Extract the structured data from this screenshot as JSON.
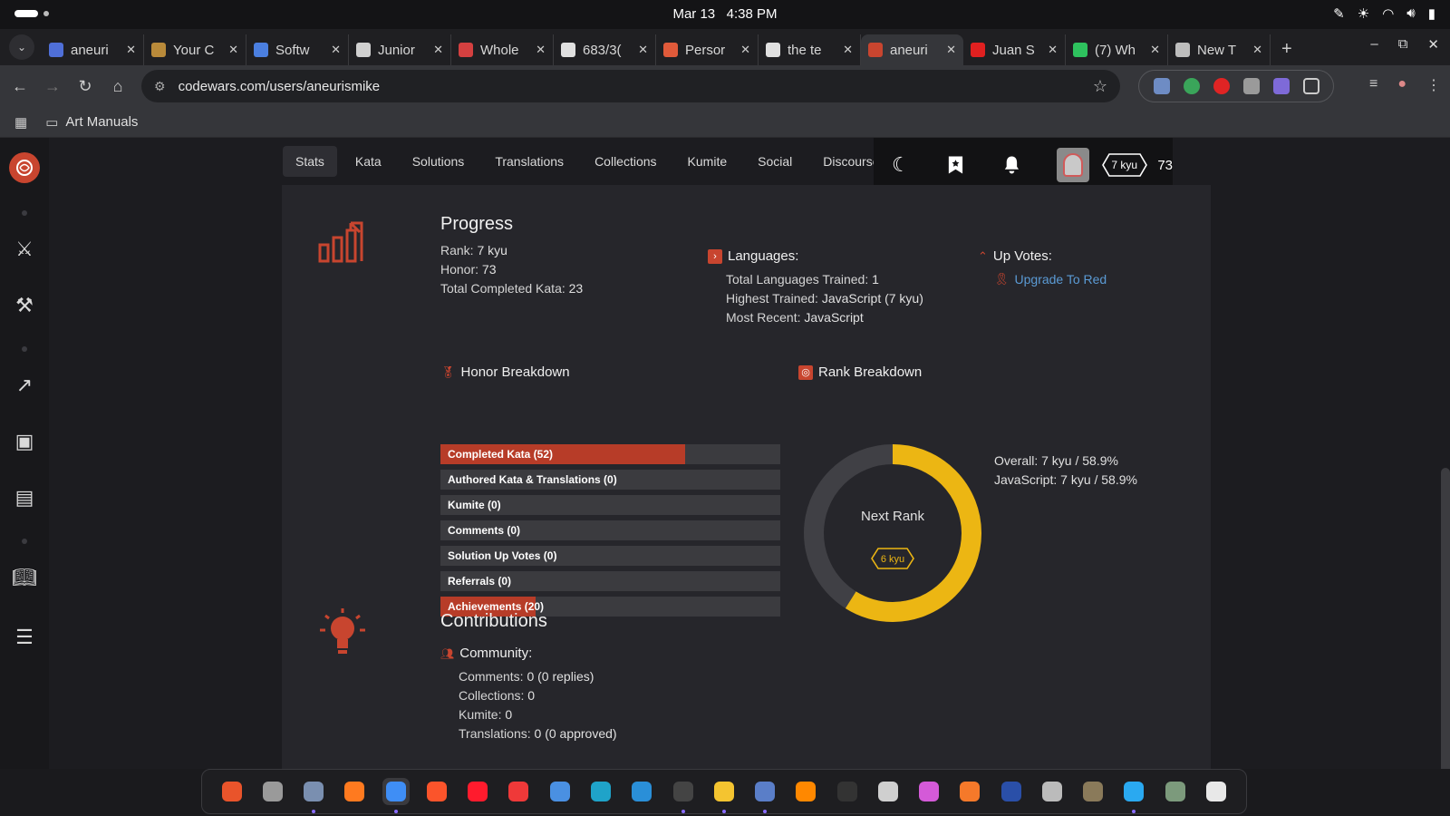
{
  "os": {
    "date": "Mar 13",
    "time": "4:38 PM"
  },
  "browser": {
    "tabs": [
      {
        "title": "aneuri",
        "color": "#4f6fd8"
      },
      {
        "title": "Your C",
        "color": "#b98a3a"
      },
      {
        "title": "Softw",
        "color": "#4b7fe0"
      },
      {
        "title": "Junior",
        "color": "#d0d0d0"
      },
      {
        "title": "Whole",
        "color": "#d44040"
      },
      {
        "title": "683/3(",
        "color": "#e0e0e0"
      },
      {
        "title": "Persor",
        "color": "#e05a3a"
      },
      {
        "title": "the te",
        "color": "#e0e0e0"
      },
      {
        "title": "aneuri",
        "color": "#c8452f",
        "active": true
      },
      {
        "title": "Juan S",
        "color": "#e02020"
      },
      {
        "title": "(7) Wh",
        "color": "#2ec25e"
      },
      {
        "title": "New T",
        "color": "#bdbdbd"
      }
    ],
    "url": "codewars.com/users/aneurismike",
    "bookmark_folder": "Art Manuals"
  },
  "profile_nav": [
    "Stats",
    "Kata",
    "Solutions",
    "Translations",
    "Collections",
    "Kumite",
    "Social",
    "Discourse"
  ],
  "user_badge": {
    "rank": "7 kyu",
    "honor": "73"
  },
  "progress": {
    "title": "Progress",
    "rank_label": "Rank:",
    "rank": "7 kyu",
    "honor_label": "Honor:",
    "honor": "73",
    "completed_label": "Total Completed Kata:",
    "completed": "23"
  },
  "languages": {
    "title": "Languages:",
    "trained_label": "Total Languages Trained:",
    "trained": "1",
    "highest_label": "Highest Trained:",
    "highest": "JavaScript (7 kyu)",
    "recent_label": "Most Recent:",
    "recent": "JavaScript"
  },
  "upvotes": {
    "title": "Up Votes:",
    "link": "Upgrade To Red"
  },
  "honor_breakdown": {
    "title": "Honor Breakdown",
    "bars": [
      {
        "label": "Completed Kata (52)",
        "fill_fraction": 0.72
      },
      {
        "label": "Authored Kata & Translations (0)",
        "fill_fraction": 0
      },
      {
        "label": "Kumite (0)",
        "fill_fraction": 0
      },
      {
        "label": "Comments (0)",
        "fill_fraction": 0
      },
      {
        "label": "Solution Up Votes (0)",
        "fill_fraction": 0
      },
      {
        "label": "Referrals (0)",
        "fill_fraction": 0
      },
      {
        "label": "Achievements (20)",
        "fill_fraction": 0.28
      }
    ]
  },
  "rank_breakdown": {
    "title": "Rank Breakdown",
    "next_rank_label": "Next Rank",
    "next_rank": "6 kyu",
    "progress_fraction": 0.589,
    "overall_label": "Overall:",
    "overall": "7 kyu / 58.9%",
    "js_label": "JavaScript:",
    "js": "7 kyu / 58.9%"
  },
  "contributions": {
    "title": "Contributions",
    "community_title": "Community:",
    "comments_label": "Comments:",
    "comments": "0 (0 replies)",
    "collections_label": "Collections:",
    "collections": "0",
    "kumite_label": "Kumite:",
    "kumite": "0",
    "translations_label": "Translations:",
    "translations": "0 (0 approved)"
  },
  "colors": {
    "accent": "#c8452f",
    "rank_yellow": "#ecb613"
  },
  "dock_apps": [
    {
      "name": "app-center",
      "color": "#e9542b"
    },
    {
      "name": "settings",
      "color": "#9a9a9a"
    },
    {
      "name": "files",
      "color": "#7a8fb0",
      "run": true
    },
    {
      "name": "firefox",
      "color": "#ff7a1f"
    },
    {
      "name": "chrome",
      "color": "#3f8ef5",
      "run": true,
      "sel": true
    },
    {
      "name": "brave",
      "color": "#fb542b"
    },
    {
      "name": "opera",
      "color": "#ff1b2d"
    },
    {
      "name": "vivaldi",
      "color": "#ef3939"
    },
    {
      "name": "chromium",
      "color": "#4a90e2"
    },
    {
      "name": "edge",
      "color": "#1fa3c9"
    },
    {
      "name": "vscode",
      "color": "#2a8fd8"
    },
    {
      "name": "terminal",
      "color": "#444444",
      "run": true
    },
    {
      "name": "notes",
      "color": "#f4c430",
      "run": true
    },
    {
      "name": "calculator",
      "color": "#5a7ec8",
      "run": true
    },
    {
      "name": "vlc",
      "color": "#ff8800"
    },
    {
      "name": "obs",
      "color": "#333333"
    },
    {
      "name": "github-desktop",
      "color": "#cfcfcf"
    },
    {
      "name": "color-picker",
      "color": "#d45ad8"
    },
    {
      "name": "blender",
      "color": "#f5792a"
    },
    {
      "name": "steam-game",
      "color": "#2a4fa8"
    },
    {
      "name": "inkscape",
      "color": "#bbbbbb"
    },
    {
      "name": "gimp",
      "color": "#8a7a5a"
    },
    {
      "name": "text-editor",
      "color": "#2aa9f0",
      "run": true
    },
    {
      "name": "trash",
      "color": "#7c9a7c"
    },
    {
      "name": "ubuntu",
      "color": "#e8e8e8"
    }
  ]
}
